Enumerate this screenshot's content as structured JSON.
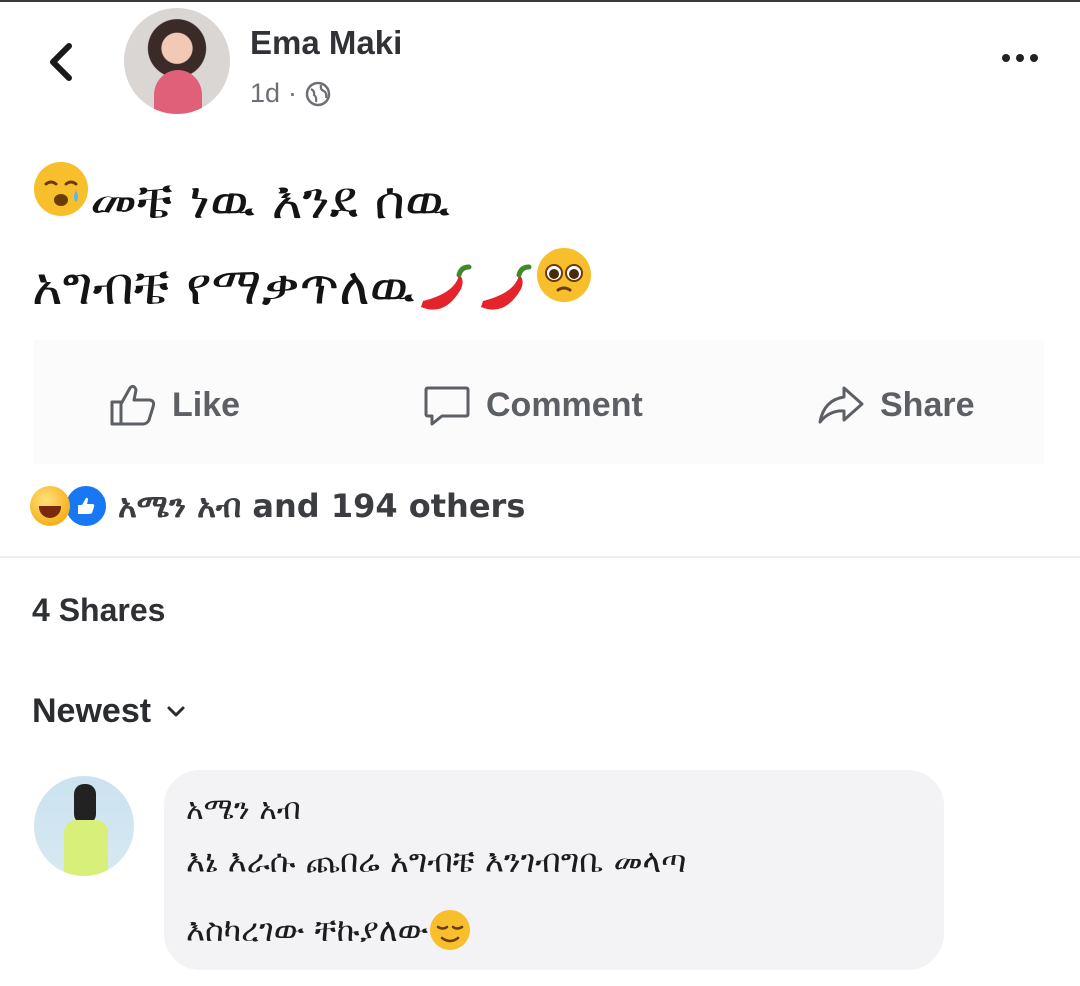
{
  "post": {
    "author": "Ema Maki",
    "time": "1d",
    "separator": "·",
    "audience_icon": "globe-icon",
    "text_line1": "መቼ ነዉ እንደ ሰዉ",
    "text_line2": "አግብቼ የማቃጥለዉ"
  },
  "actions": {
    "like": "Like",
    "comment": "Comment",
    "share": "Share"
  },
  "reactions": {
    "text": "አሜን አብ and 194 others",
    "icons": [
      "haha-icon",
      "like-icon"
    ]
  },
  "shares": "4 Shares",
  "sort": {
    "label": "Newest"
  },
  "comments": [
    {
      "name": "አሜን አብ",
      "line1": "እኔ እራሱ ጨበሬ አግብቼ እንገብግቤ መላጣ",
      "line2": "እስካረገው ቸኩያለው"
    }
  ],
  "colors": {
    "like_blue": "#1877f2",
    "action_gray": "#5c5f64",
    "bubble_bg": "#f3f3f5"
  }
}
